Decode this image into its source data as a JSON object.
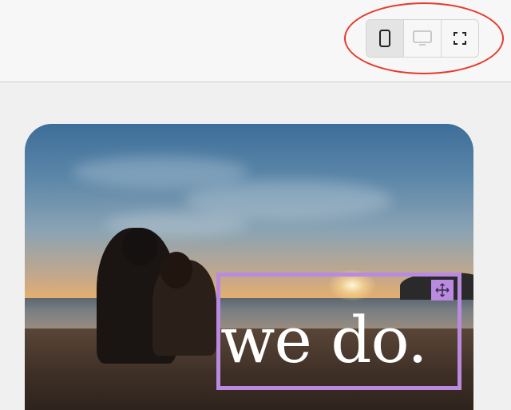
{
  "toolbar": {
    "view_modes": [
      {
        "id": "mobile",
        "icon": "mobile-phone-icon",
        "active": true
      },
      {
        "id": "desktop",
        "icon": "desktop-monitor-icon",
        "active": false
      },
      {
        "id": "fullscreen",
        "icon": "fullscreen-icon",
        "active": false
      }
    ],
    "highlight_color": "#e8392c"
  },
  "canvas": {
    "headline": "we do.",
    "selection_color": "#b98ae0",
    "move_icon": "move-arrows-icon",
    "image_subject": "couple-on-beach-at-sunset"
  }
}
